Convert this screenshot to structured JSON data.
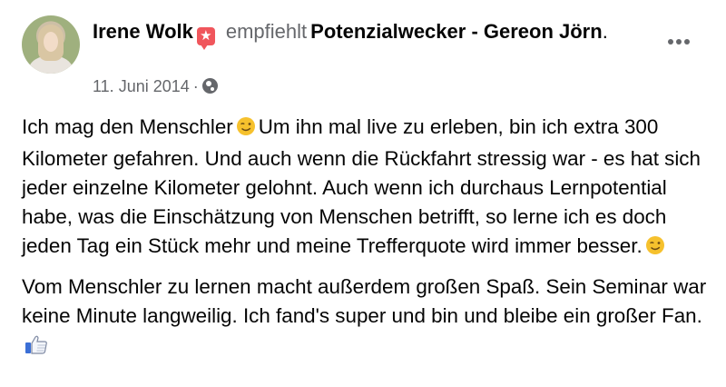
{
  "post": {
    "author": "Irene Wolk",
    "verb": "empfiehlt",
    "page": "Potenzialwecker - Gereon Jörn",
    "period": ".",
    "date": "11. Juni 2014",
    "separator": "·",
    "privacy_icon": "globe-icon",
    "recommend_icon": "star-badge-icon",
    "more_icon": "more-options-icon",
    "paragraphs": [
      {
        "text_1": "Ich mag den Menschler",
        "text_2": "Um ihn mal live zu erleben, bin ich extra 300 Kilometer gefahren. Und auch wenn die Rückfahrt stressig war - es hat sich jeder einzelne Kilometer gelohnt. Auch wenn ich durchaus Lernpotential habe, was die Einschätzung von Menschen betrifft, so lerne ich es doch jeden Tag ein Stück mehr und meine Trefferquote wird immer besser.",
        "emoji": "winking-face-emoji"
      },
      {
        "text_1": "Vom Menschler zu lernen macht außerdem großen Spaß. Sein Seminar war keine Minute langweilig. Ich fand's super und bin und bleibe ein großer Fan.",
        "emoji": "thumbs-up-emoji"
      }
    ]
  },
  "colors": {
    "text": "#050505",
    "secondary": "#65676b",
    "badge": "#f0565c",
    "thumb": "#3b6fd6"
  }
}
